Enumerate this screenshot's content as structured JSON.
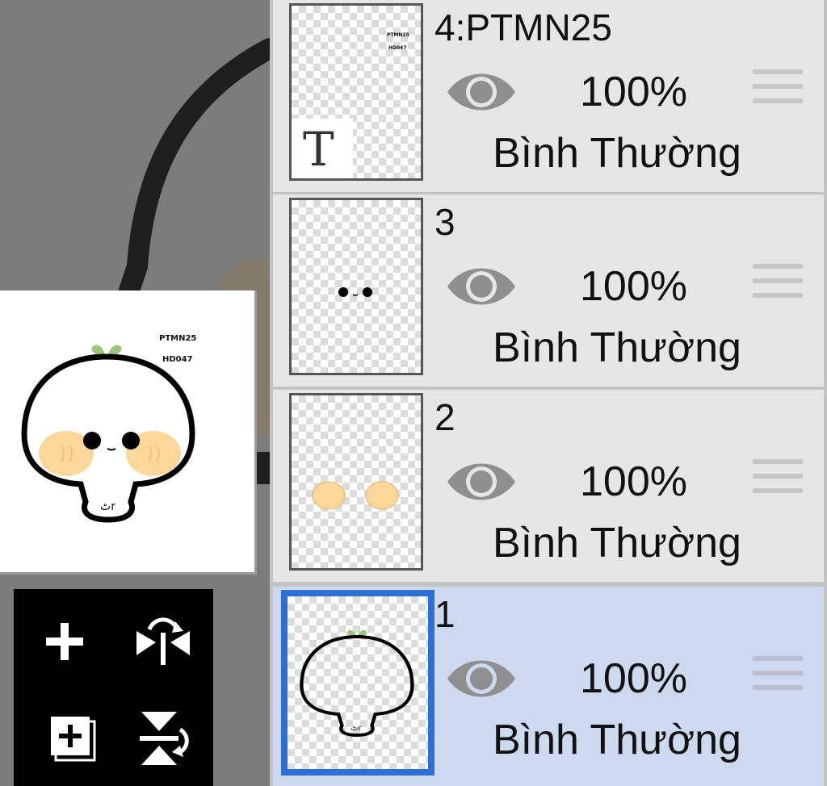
{
  "layers_panel": {
    "layers": [
      {
        "name": "4:PTMN25",
        "opacity": "100%",
        "blend_mode": "Bình Thường",
        "visible": true,
        "selected": false,
        "thumb": "text-layer"
      },
      {
        "name": "3",
        "opacity": "100%",
        "blend_mode": "Bình Thường",
        "visible": true,
        "selected": false,
        "thumb": "eyes"
      },
      {
        "name": "2",
        "opacity": "100%",
        "blend_mode": "Bình Thường",
        "visible": true,
        "selected": false,
        "thumb": "cheeks"
      },
      {
        "name": "1",
        "opacity": "100%",
        "blend_mode": "Bình Thường",
        "visible": true,
        "selected": true,
        "thumb": "outline"
      }
    ]
  },
  "thumbnail_text": {
    "layer4_line1": "PTMN25",
    "layer4_line2": "HD047",
    "text_layer_glyph": "T",
    "mouth": "ٹr"
  },
  "preview": {
    "text_line1": "PTMN25",
    "text_line2": "HD047",
    "mouth": "ٹr"
  },
  "tools": {
    "add_layer_icon": "plus-icon",
    "flip_horizontal_icon": "flip-horizontal-icon",
    "add_from_copy_icon": "add-copy-icon",
    "flip_vertical_icon": "flip-vertical-icon"
  },
  "colors": {
    "accent_selected_border": "#2c6fd6",
    "selected_row_bg": "#ccd9ef",
    "row_bg": "#e6e6e6",
    "cheek": "#fbd79a",
    "sprout": "#9bc47c"
  }
}
